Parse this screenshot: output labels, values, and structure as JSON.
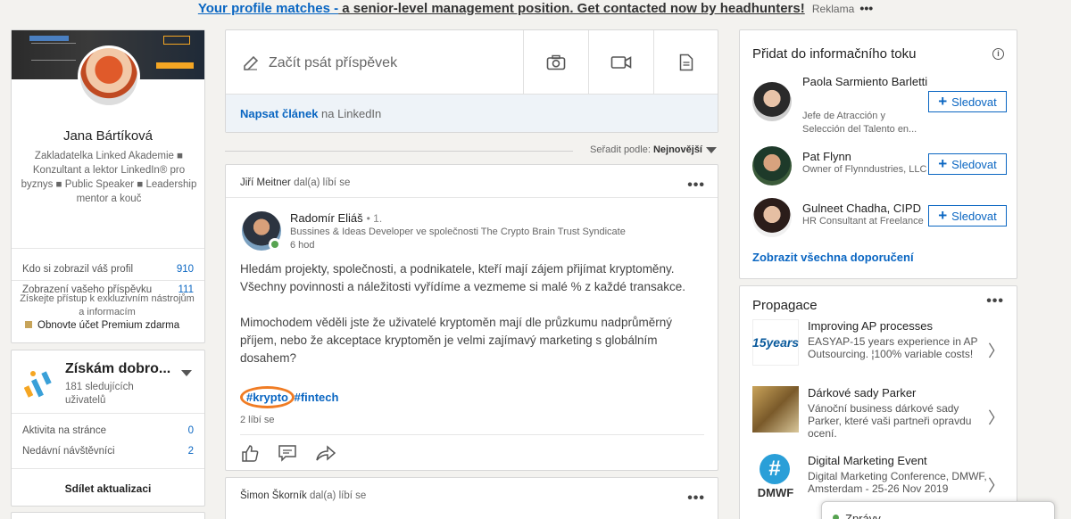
{
  "top_ad": {
    "link_text": "Your profile matches -",
    "rest_text": " a senior-level management position. Get contacted now by headhunters!",
    "ad_label": "Reklama",
    "more": "•••"
  },
  "profile": {
    "name": "Jana Bártíková",
    "headline": "Zakladatelka Linked Akademie ■ Konzultant a lektor LinkedIn® pro byznys ■ Public Speaker ■ Leadership mentor a kouč",
    "stats": [
      {
        "label": "Kdo si zobrazil váš profil",
        "value": "910"
      },
      {
        "label": "Zobrazení vašeho příspěvku",
        "value": "111"
      }
    ],
    "premium_text": "Získejte přístup k exkluzivním nástrojům a informacím",
    "premium_link": "Obnovte účet Premium zdarma"
  },
  "group": {
    "title": "Získám dobro...",
    "followers": "181 sledujících uživatelů",
    "stats": [
      {
        "label": "Aktivita na stránce",
        "value": "0"
      },
      {
        "label": "Nedávní návštěvníci",
        "value": "2"
      }
    ],
    "share": "Sdílet aktualizaci"
  },
  "composer": {
    "start_post": "Začít psát příspěvek",
    "article_link": "Napsat článek",
    "article_suffix": " na LinkedIn"
  },
  "sort": {
    "prefix": "Seřadit podle: ",
    "value": "Nejnovější"
  },
  "post": {
    "liker_name": "Jiří Meitner",
    "liker_action": " dal(a) líbí se",
    "author": "Radomír Eliáš",
    "degree": "• 1.",
    "author_title": "Bussines & Ideas Developer ve společnosti The Crypto Brain Trust Syndicate",
    "time": "6 hod",
    "paragraph1": "Hledám projekty, společnosti, a podnikatele, kteří mají zájem přijímat kryptoměny. Všechny povinnosti a náležitosti vyřídíme a vezmeme si malé % z každé  transakce.",
    "paragraph2": "Mimochodem věděli jste že uživatelé kryptoměn mají dle průzkumu nadprůměrný příjem, nebo že akceptace kryptoměn je velmi zajímavý marketing s globálním dosahem?",
    "hashtag1": "#krypto",
    "hashtag2": "#fintech",
    "likes": "2 líbí se"
  },
  "post2": {
    "liker_name": "Šimon Škorník",
    "liker_action": " dal(a) líbí se"
  },
  "suggest": {
    "title": "Přidat do informačního toku",
    "people": [
      {
        "name": "Paola Sarmiento Barletti",
        "title": "Jefe de Atracción y Selección del Talento en..."
      },
      {
        "name": "Pat Flynn",
        "title": "Owner of Flynndustries, LLC"
      },
      {
        "name": "Gulneet Chadha, CIPD",
        "title": "HR Consultant at Freelance"
      }
    ],
    "follow_label": "Sledovat",
    "show_all": "Zobrazit všechna doporučení"
  },
  "promo": {
    "title": "Propagace",
    "items": [
      {
        "title": "Improving AP processes",
        "desc": "EASYAP-15 years experience in AP Outsourcing. ¦100% variable costs!",
        "thumb_text": "15years"
      },
      {
        "title": "Dárkové sady Parker",
        "desc": "Vánoční business dárkové sady Parker, které vaši partneři opravdu ocení."
      },
      {
        "title": "Digital Marketing Event",
        "desc": "Digital Marketing Conference, DMWF, Amsterdam - 25-26 Nov 2019",
        "thumb_text": "DMWF"
      }
    ]
  },
  "messages": {
    "label": "Zprávy"
  },
  "colors": {
    "accent": "#0a66c2",
    "highlight_ring": "#f07c24",
    "online": "#57a351"
  }
}
